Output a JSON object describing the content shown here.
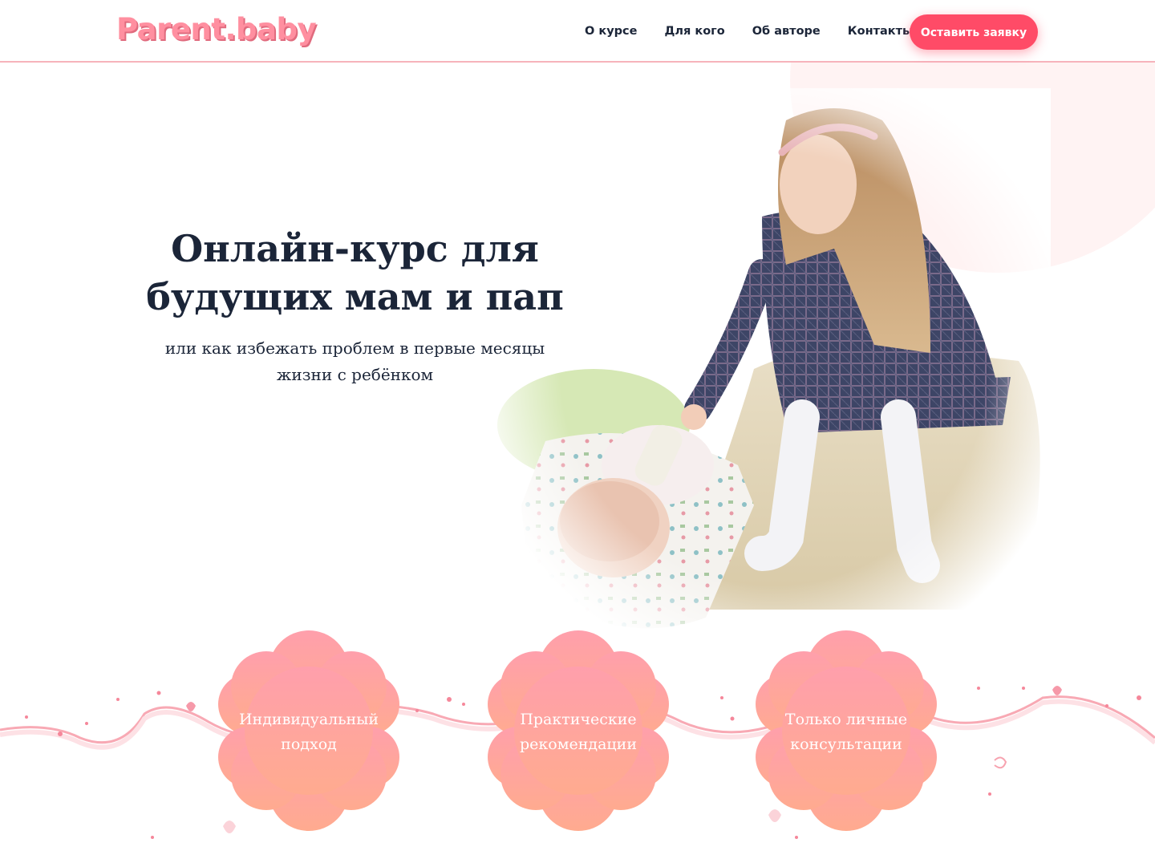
{
  "header": {
    "logo": "Parent.baby",
    "nav": [
      "О курсе",
      "Для кого",
      "Об авторе",
      "Контакты"
    ],
    "cta_label": "Оставить заявку"
  },
  "hero": {
    "title": "Онлайн-курс для будущих мам и пап",
    "subtitle": "или как избежать проблем в первые месяцы жизни с ребёнком"
  },
  "features": [
    "Индивидуальный подход",
    "Практические рекомендации",
    "Только личные консультации"
  ],
  "colors": {
    "accent": "#ff4b67",
    "flower_top": "#ff9fac",
    "flower_bottom": "#ffa990",
    "text": "#1b2538"
  }
}
